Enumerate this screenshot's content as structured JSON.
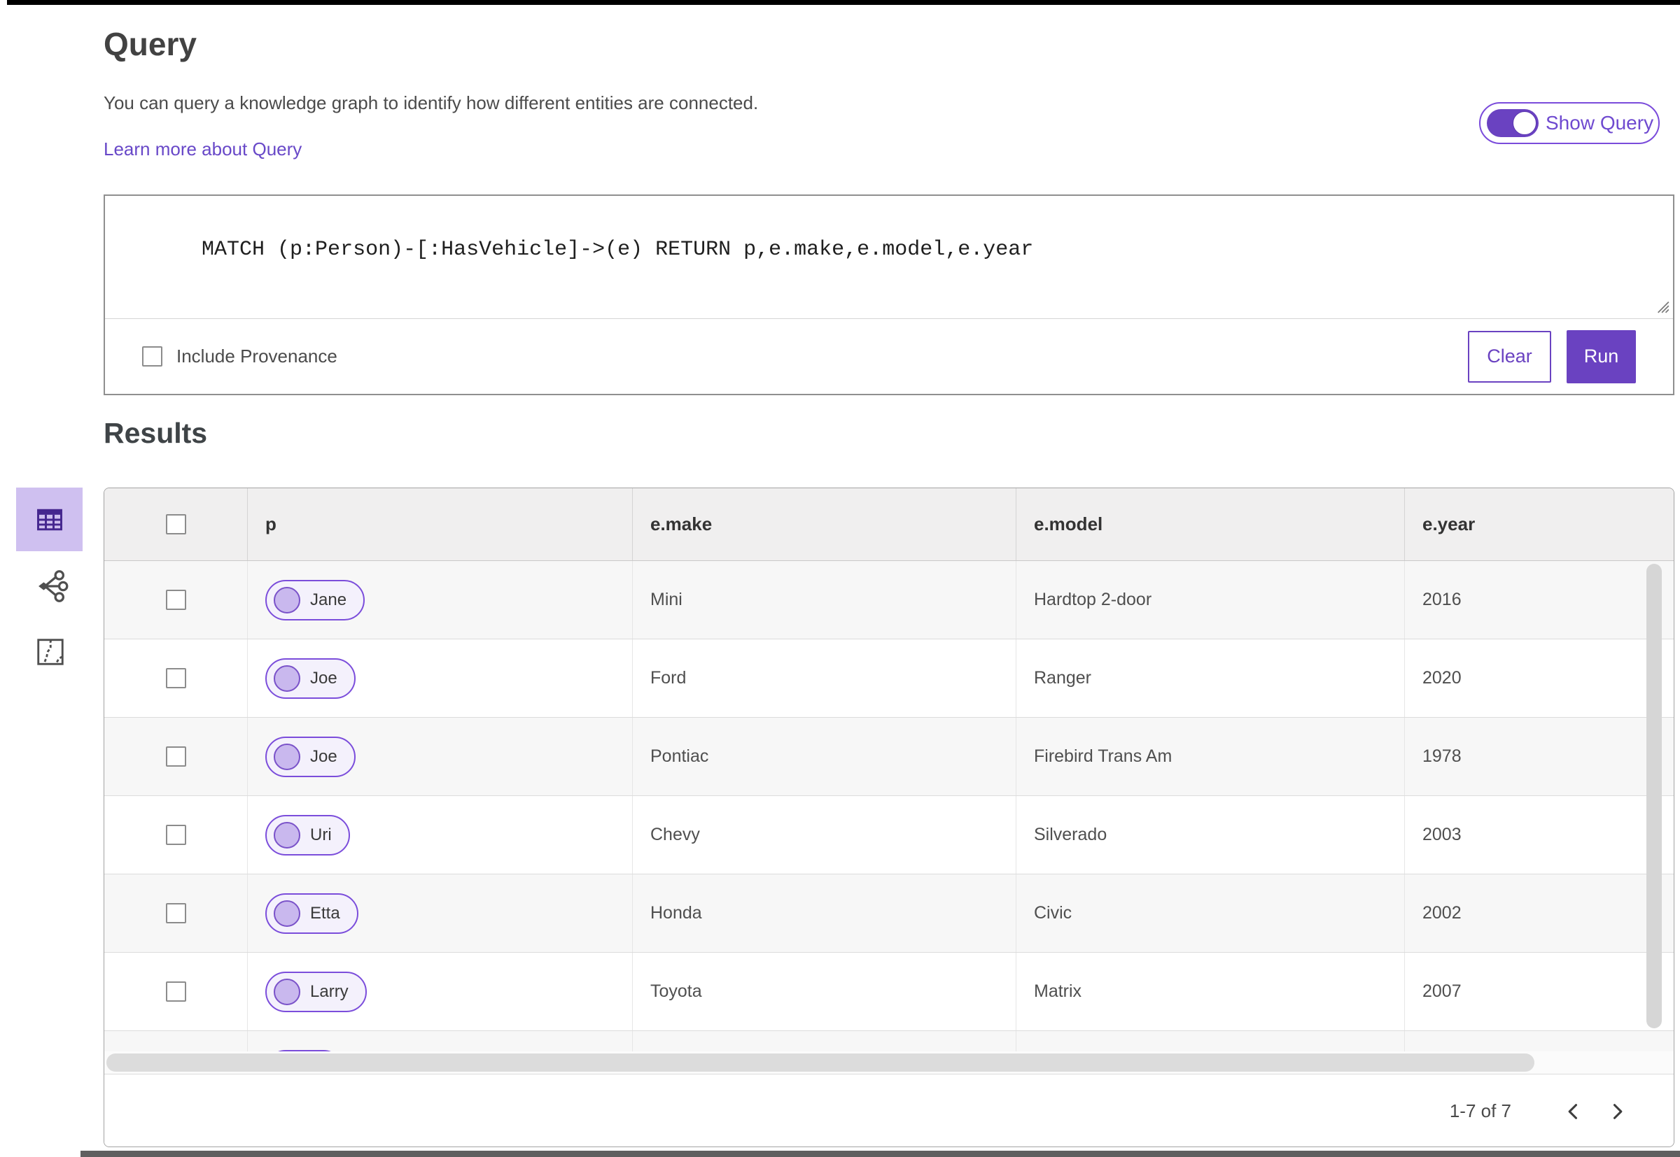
{
  "header": {
    "title": "Query",
    "description": "You can query a knowledge graph to identify how different entities are connected.",
    "learn_more_label": "Learn more about Query",
    "show_query_label": "Show Query",
    "show_query_on": true
  },
  "query_editor": {
    "query_text": "MATCH (p:Person)-[:HasVehicle]->(e) RETURN p,e.make,e.model,e.year",
    "include_provenance_label": "Include Provenance",
    "include_provenance_checked": false,
    "clear_label": "Clear",
    "run_label": "Run"
  },
  "results": {
    "heading": "Results",
    "view_rail": {
      "active_view": "table-view",
      "icons": [
        "table-view-icon",
        "link-chart-view-icon",
        "map-view-icon"
      ]
    },
    "table": {
      "columns": [
        "p",
        "e.make",
        "e.model",
        "e.year"
      ],
      "rows": [
        {
          "p": "Jane",
          "make": "Mini",
          "model": "Hardtop 2-door",
          "year": "2016"
        },
        {
          "p": "Joe",
          "make": "Ford",
          "model": "Ranger",
          "year": "2020"
        },
        {
          "p": "Joe",
          "make": "Pontiac",
          "model": "Firebird Trans Am",
          "year": "1978"
        },
        {
          "p": "Uri",
          "make": "Chevy",
          "model": "Silverado",
          "year": "2003"
        },
        {
          "p": "Etta",
          "make": "Honda",
          "model": "Civic",
          "year": "2002"
        },
        {
          "p": "Larry",
          "make": "Toyota",
          "model": "Matrix",
          "year": "2007"
        },
        {
          "p": "",
          "make": "",
          "model": "",
          "year": ""
        }
      ]
    },
    "pagination": {
      "range_label": "1-7 of 7"
    }
  },
  "colors": {
    "accent": "#6a42c1",
    "badge_border": "#7b4ddb",
    "badge_fill": "#f4f1fc",
    "badge_circle": "#c9b8ee",
    "active_tile": "#cfc0f0",
    "header_bg": "#f0efef",
    "row_stripe": "#f7f7f7"
  }
}
